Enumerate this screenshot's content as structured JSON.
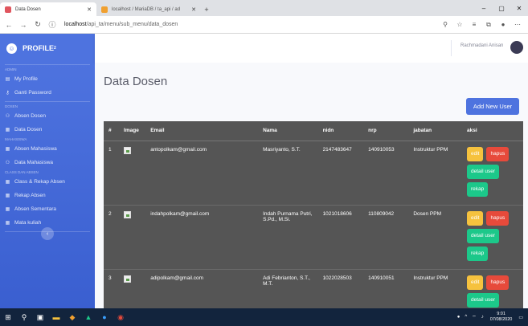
{
  "browser": {
    "tabs": [
      {
        "label": "Data Dosen",
        "active": true,
        "color": "#e0555e"
      },
      {
        "label": "localhost / MariaDB / ta_api / ad",
        "active": false,
        "color": "#f0a030"
      }
    ],
    "new_tab": "+",
    "url_host": "localhost",
    "url_path": "/api_ta/menu/sub_menu/data_dosen",
    "window_controls": [
      "–",
      "▢",
      "✕"
    ]
  },
  "sidebar": {
    "brand": "PROFILE",
    "brand_sup": "2",
    "sections": [
      {
        "heading": "ADMIN",
        "items": [
          {
            "label": "My Profile",
            "icon": "id-card-icon"
          },
          {
            "label": "Ganti Password",
            "icon": "key-icon"
          }
        ]
      },
      {
        "heading": "DOSEN",
        "items": [
          {
            "label": "Absen Dosen",
            "icon": "users-icon"
          },
          {
            "label": "Data Dosen",
            "icon": "table-icon"
          }
        ]
      },
      {
        "heading": "MAHASISWA",
        "items": [
          {
            "label": "Absen Mahasiswa",
            "icon": "table-icon"
          },
          {
            "label": "Data Mahasiswa",
            "icon": "users-icon"
          }
        ]
      },
      {
        "heading": "CLASS DAN ABSEN",
        "items": [
          {
            "label": "Class & Rekap Absen",
            "icon": "table-icon"
          },
          {
            "label": "Rekap Absen",
            "icon": "table-icon"
          },
          {
            "label": "Absen Sementara",
            "icon": "table-icon"
          },
          {
            "label": "Mata kuliah",
            "icon": "table-icon"
          }
        ]
      }
    ],
    "toggle": "‹"
  },
  "topbar": {
    "user_name": "Rachmadani Anisan"
  },
  "page": {
    "title": "Data Dosen",
    "add_button": "Add New User"
  },
  "table": {
    "headers": [
      "#",
      "Image",
      "Email",
      "Nama",
      "nidn",
      "nrp",
      "jabatan",
      "aksi"
    ],
    "rows": [
      {
        "no": "1",
        "email": "antopolkam@gmail.com",
        "nama": "Masriyanto, S.T.",
        "nidn": "2147483647",
        "nrp": "140910053",
        "jabatan": "Instruktur PPM"
      },
      {
        "no": "2",
        "email": "indahpolkam@gmail.com",
        "nama": "Indah Purnama Putri, S.Pd., M.Si.",
        "nidn": "1021018606",
        "nrp": "110809042",
        "jabatan": "Dosen PPM"
      },
      {
        "no": "3",
        "email": "adipolkam@gmail.com",
        "nama": "Adi Febrianton, S.T., M.T.",
        "nidn": "1022028503",
        "nrp": "140910051",
        "jabatan": "Instruktur PPM"
      }
    ],
    "actions": {
      "edit": "edit",
      "hapus": "hapus",
      "detail": "detail user",
      "rekap": "rekap"
    }
  },
  "taskbar": {
    "time": "9:01",
    "date": "07/08/2020"
  }
}
